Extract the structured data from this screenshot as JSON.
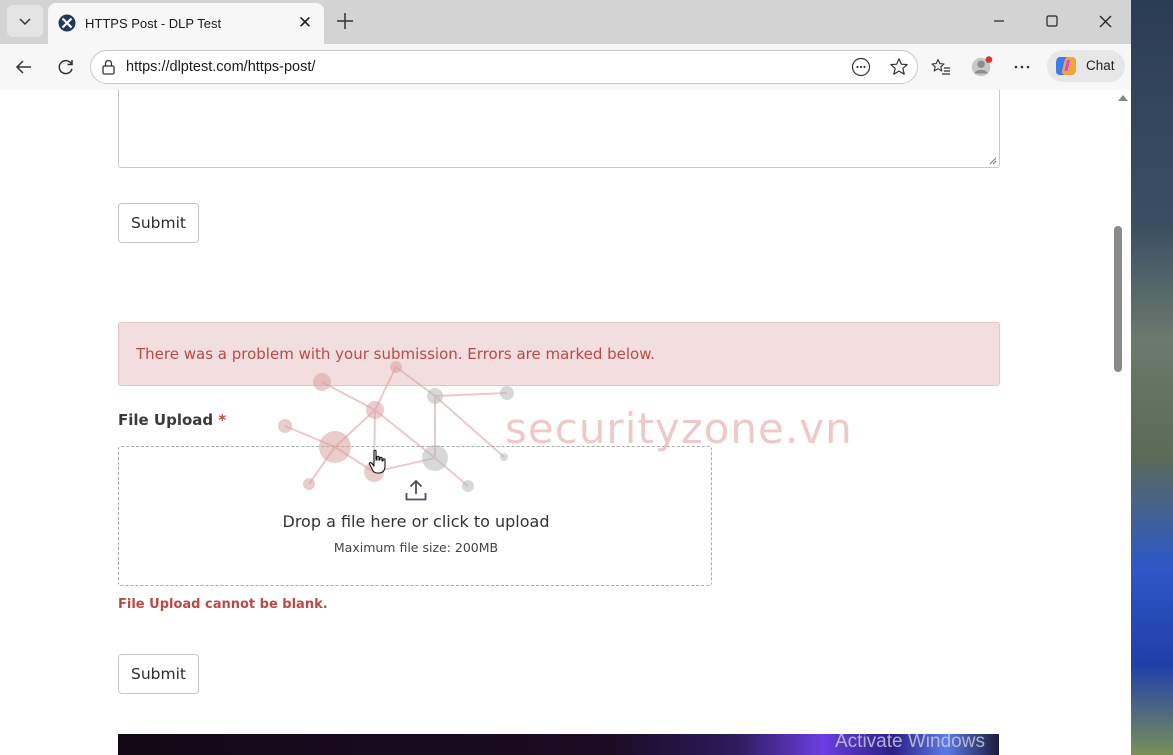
{
  "browser": {
    "tab_title": "HTTPS Post - DLP Test",
    "url": "https://dlptest.com/https-post/",
    "chat_label": "Chat"
  },
  "page": {
    "submit_label": "Submit",
    "error_alert": "There was a problem with your submission. Errors are marked below.",
    "file_upload_label": "File Upload",
    "required_marker": "*",
    "drop_text": "Drop a file here or click to upload",
    "max_size_text": "Maximum file size: 200MB",
    "field_error": "File Upload cannot be blank."
  },
  "overlay": {
    "watermark_text": "securityzone.vn",
    "os_watermark": "Activate Windows"
  },
  "colors": {
    "error_red": "#b94a48",
    "alert_bg": "#f2dede"
  }
}
